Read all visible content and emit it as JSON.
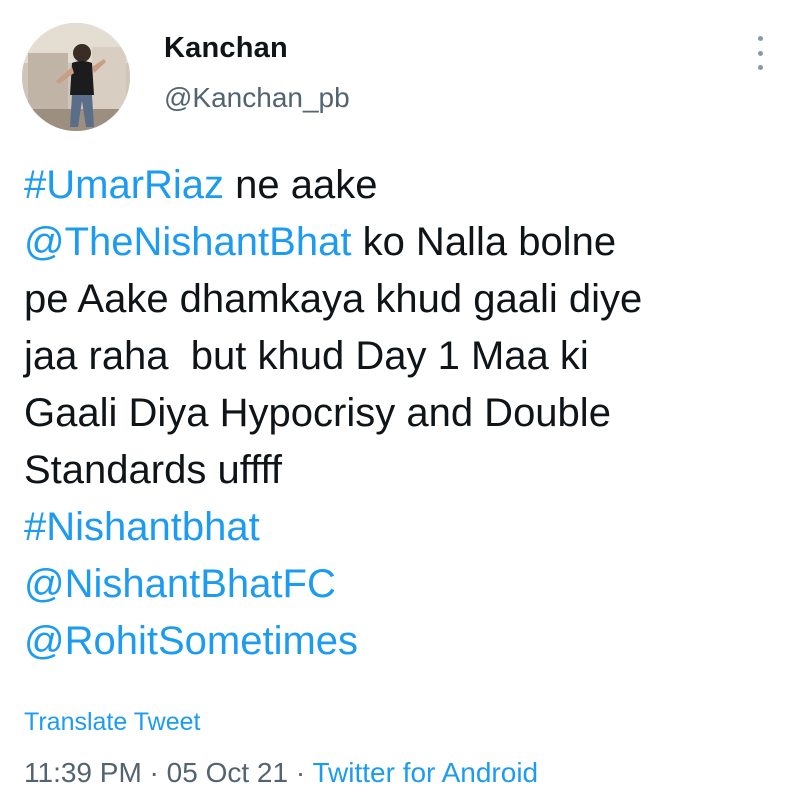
{
  "author": {
    "display_name": "Kanchan",
    "handle": "@Kanchan_pb"
  },
  "tweet": {
    "lines": [
      [
        {
          "text": "#UmarRiaz",
          "kind": "hashtag"
        },
        {
          "text": " ne aake",
          "kind": "text"
        }
      ],
      [
        {
          "text": "@TheNishantBhat",
          "kind": "mention"
        },
        {
          "text": " ko Nalla bolne",
          "kind": "text"
        }
      ],
      [
        {
          "text": "pe Aake dhamkaya khud gaali diye",
          "kind": "text"
        }
      ],
      [
        {
          "text": "jaa raha  but khud Day 1 Maa ki",
          "kind": "text"
        }
      ],
      [
        {
          "text": "Gaali Diya Hypocrisy and Double",
          "kind": "text"
        }
      ],
      [
        {
          "text": "Standards uffff",
          "kind": "text"
        }
      ],
      [
        {
          "text": "#Nishantbhat",
          "kind": "hashtag"
        }
      ],
      [
        {
          "text": "@NishantBhatFC",
          "kind": "mention"
        }
      ],
      [
        {
          "text": "@RohitSometimes",
          "kind": "mention"
        }
      ]
    ],
    "translate_label": "Translate Tweet"
  },
  "meta": {
    "time": "11:39 PM",
    "separator": " · ",
    "date": "05 Oct 21",
    "source": "Twitter for Android"
  },
  "icons": {
    "more": "more-vertical-icon",
    "avatar": "profile-photo"
  },
  "colors": {
    "link": "#1d9bf0",
    "secondary": "#536471",
    "primary": "#0f1419"
  }
}
